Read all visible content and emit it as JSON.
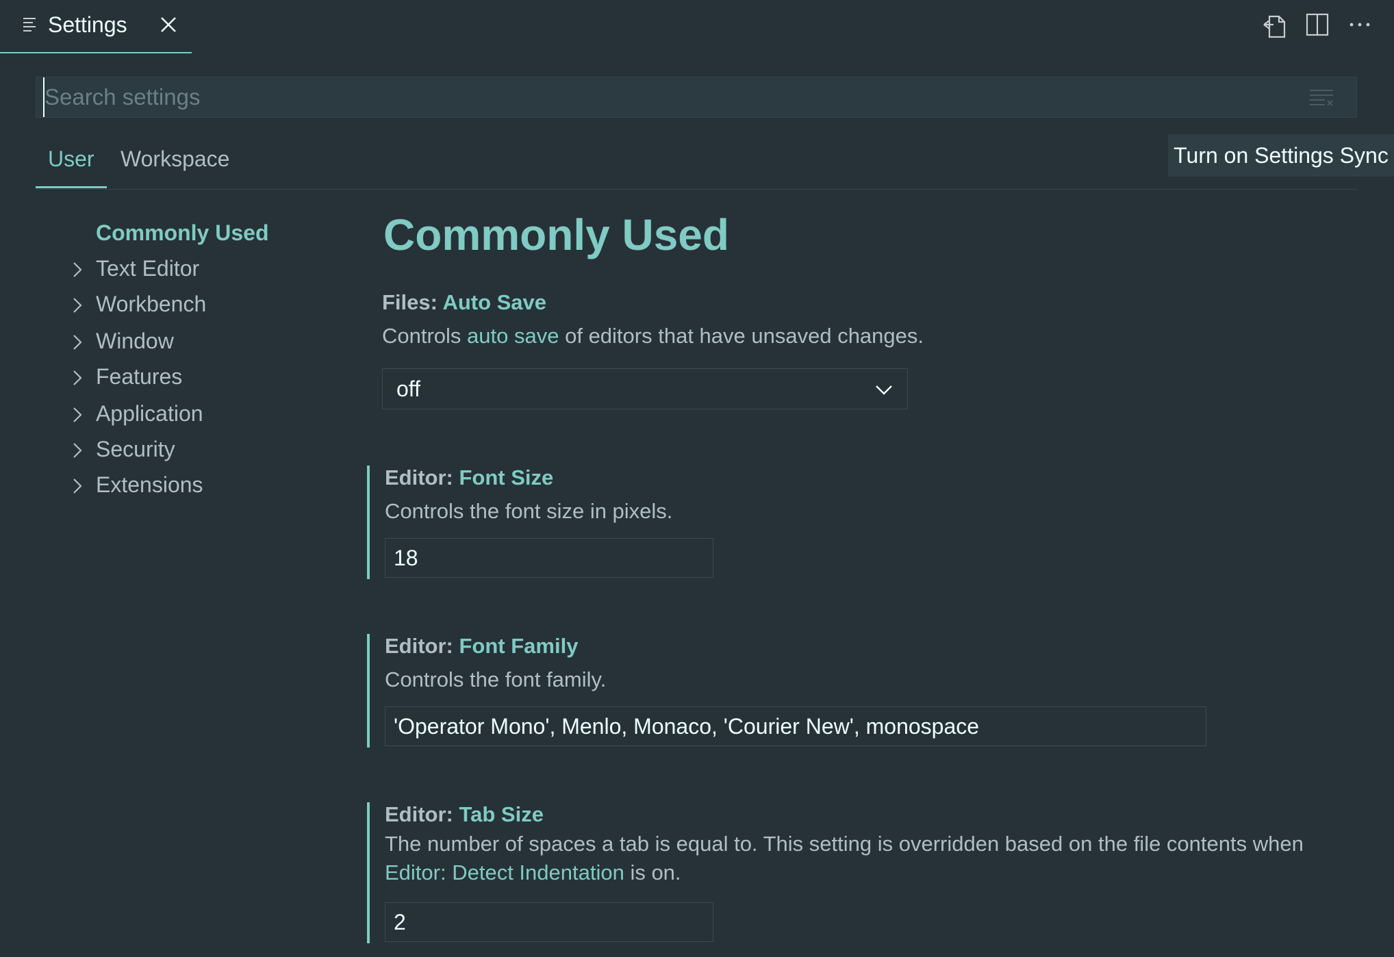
{
  "tab": {
    "title": "Settings"
  },
  "search": {
    "placeholder": "Search settings",
    "value": ""
  },
  "scopes": {
    "user": "User",
    "workspace": "Workspace",
    "sync_button": "Turn on Settings Sync"
  },
  "toc": {
    "items": [
      {
        "label": "Commonly Used",
        "active": true
      },
      {
        "label": "Text Editor"
      },
      {
        "label": "Workbench"
      },
      {
        "label": "Window"
      },
      {
        "label": "Features"
      },
      {
        "label": "Application"
      },
      {
        "label": "Security"
      },
      {
        "label": "Extensions"
      }
    ]
  },
  "section": {
    "title": "Commonly Used"
  },
  "settings": {
    "auto_save": {
      "category": "Files: ",
      "name": "Auto Save",
      "desc_pre": "Controls ",
      "desc_link": "auto save",
      "desc_post": " of editors that have unsaved changes.",
      "value": "off"
    },
    "font_size": {
      "category": "Editor: ",
      "name": "Font Size",
      "desc": "Controls the font size in pixels.",
      "value": "18"
    },
    "font_family": {
      "category": "Editor: ",
      "name": "Font Family",
      "desc": "Controls the font family.",
      "value": "'Operator Mono', Menlo, Monaco, 'Courier New', monospace"
    },
    "tab_size": {
      "category": "Editor: ",
      "name": "Tab Size",
      "desc_line1": "The number of spaces a tab is equal to. This setting is overridden based on the file contents when",
      "desc_link": "Editor: Detect Indentation",
      "desc_post": " is on.",
      "value": "2"
    }
  },
  "colors": {
    "background": "#263238",
    "accent": "#80cbc4",
    "text": "#b0bec5",
    "input_border": "#3a4a51"
  },
  "icons": {
    "tab": "settings-list-icon",
    "close": "close-icon",
    "open_json": "open-settings-json-icon",
    "split": "split-editor-icon",
    "more": "more-actions-icon",
    "clear": "clear-filter-icon",
    "chevron_right": "chevron-right-icon",
    "chevron_down": "chevron-down-icon"
  }
}
